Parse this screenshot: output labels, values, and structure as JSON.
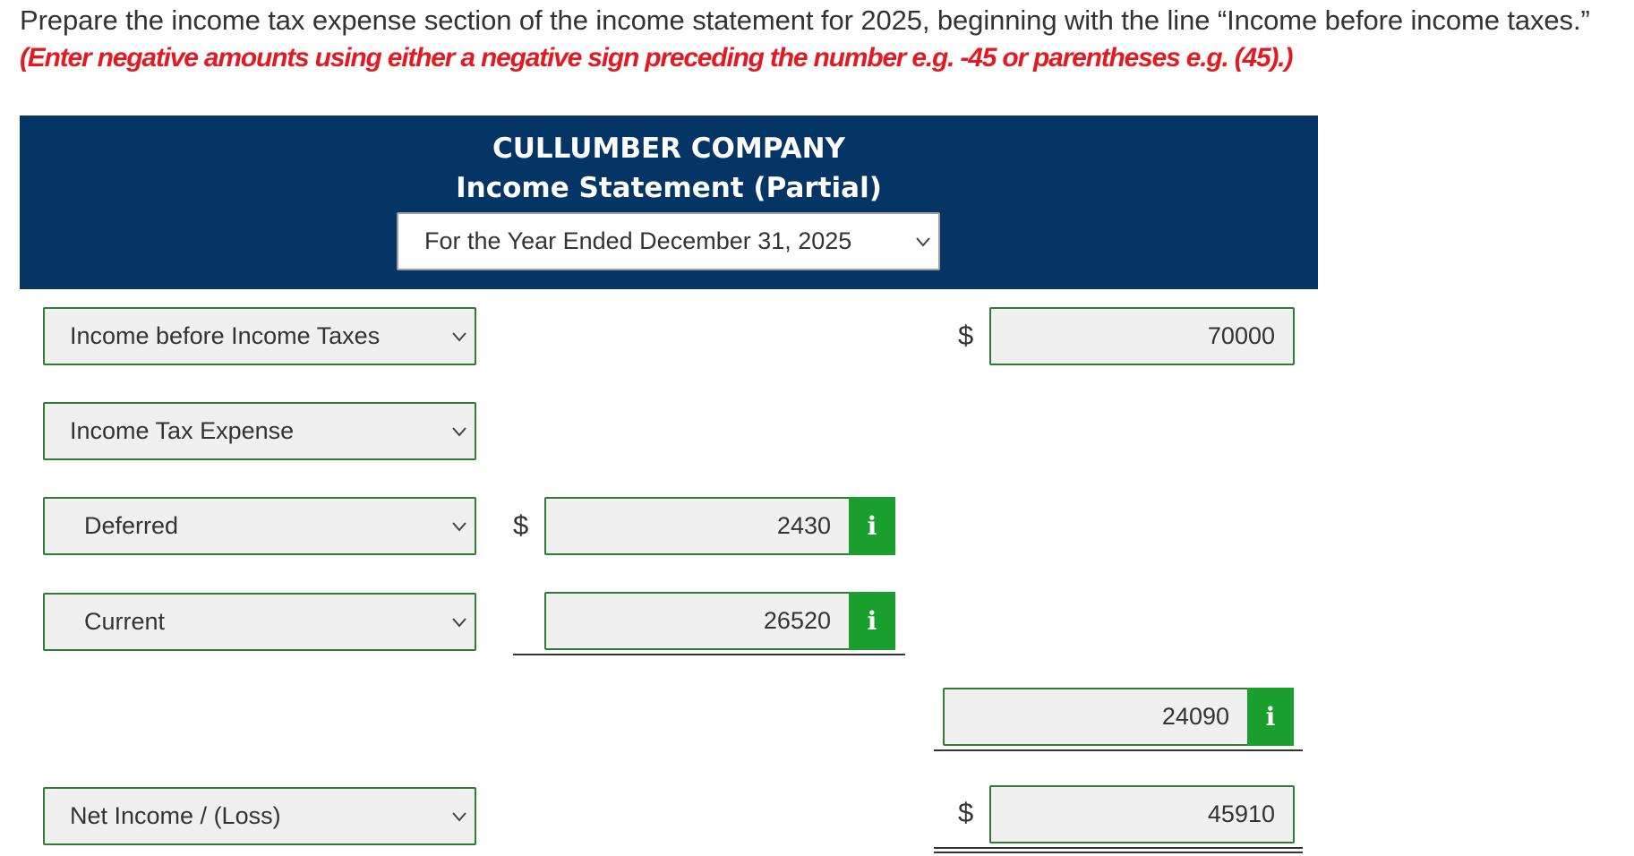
{
  "instructions": {
    "main": "Prepare the income tax expense section of the income statement for 2025, beginning with the line “Income before income taxes.”",
    "note": "(Enter negative amounts using either a negative sign preceding the number e.g. -45 or parentheses e.g. (45).)"
  },
  "header": {
    "company": "CULLUMBER COMPANY",
    "statement": "Income Statement (Partial)",
    "period": "For the Year Ended December 31, 2025"
  },
  "rows": {
    "income_before_taxes": {
      "label": "Income before Income Taxes",
      "currency": "$",
      "amount": "70000"
    },
    "income_tax_expense": {
      "label": "Income Tax Expense"
    },
    "deferred": {
      "label": "Deferred",
      "currency": "$",
      "amount": "2430",
      "info": "i"
    },
    "current": {
      "label": "Current",
      "amount": "26520",
      "info": "i"
    },
    "total_tax": {
      "amount": "24090",
      "info": "i"
    },
    "net_income": {
      "label": "Net Income / (Loss)",
      "currency": "$",
      "amount": "45910"
    }
  },
  "colors": {
    "header_bg": "#043565",
    "accent_green": "#1a9e2e",
    "input_border": "#2e7d32",
    "instruction_red": "#e21b23"
  },
  "icons": {
    "dropdown": "chevron-down-icon",
    "info": "info-icon"
  }
}
